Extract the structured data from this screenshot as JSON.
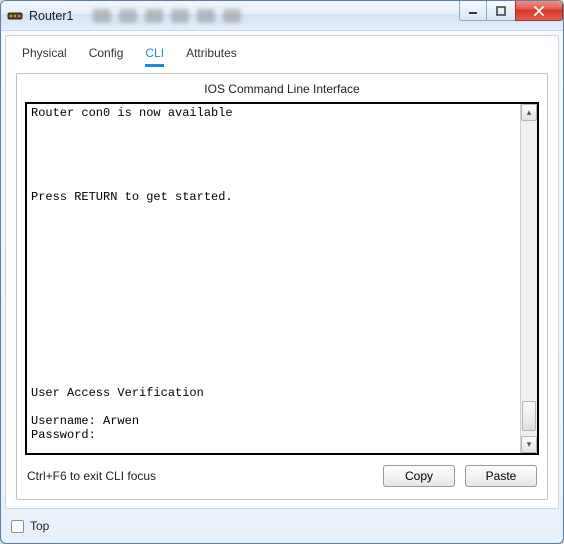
{
  "window": {
    "title": "Router1"
  },
  "tabs": {
    "physical": "Physical",
    "config": "Config",
    "cli": "CLI",
    "attributes": "Attributes",
    "active": "cli"
  },
  "cli": {
    "panel_title": "IOS Command Line Interface",
    "terminal_text": "Router con0 is now available\n\n\n\n\n\nPress RETURN to get started.\n\n\n\n\n\n\n\n\n\n\n\n\n\nUser Access Verification\n\nUsername: Arwen\nPassword:",
    "hint": "Ctrl+F6 to exit CLI focus",
    "copy_label": "Copy",
    "paste_label": "Paste"
  },
  "bottom": {
    "top_label": "Top",
    "top_checked": false
  }
}
